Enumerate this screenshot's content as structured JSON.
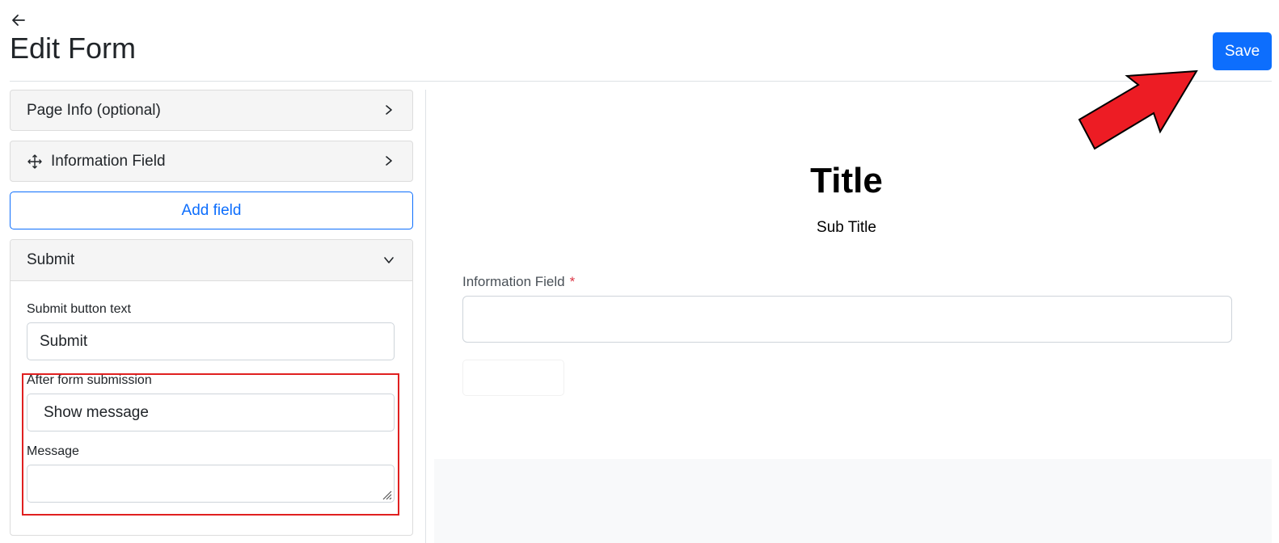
{
  "header": {
    "title": "Edit Form",
    "save_label": "Save",
    "back_icon": "arrow-left-icon"
  },
  "left_panel": {
    "page_info_label": "Page Info (optional)",
    "information_field_label": "Information Field",
    "add_field_label": "Add field",
    "submit_section": {
      "title": "Submit",
      "submit_button_text_label": "Submit button text",
      "submit_button_text_value": "Submit",
      "after_submission_label": "After form submission",
      "after_submission_value": "Show message",
      "message_label": "Message",
      "message_value": ""
    }
  },
  "preview": {
    "title": "Title",
    "subtitle": "Sub Title",
    "field_label": "Information Field",
    "required_mark": "*",
    "field_value": ""
  },
  "colors": {
    "accent": "#0d6efd",
    "highlight": "#e02020",
    "annotation_arrow": "#ed1c24",
    "required": "#dc3545"
  }
}
